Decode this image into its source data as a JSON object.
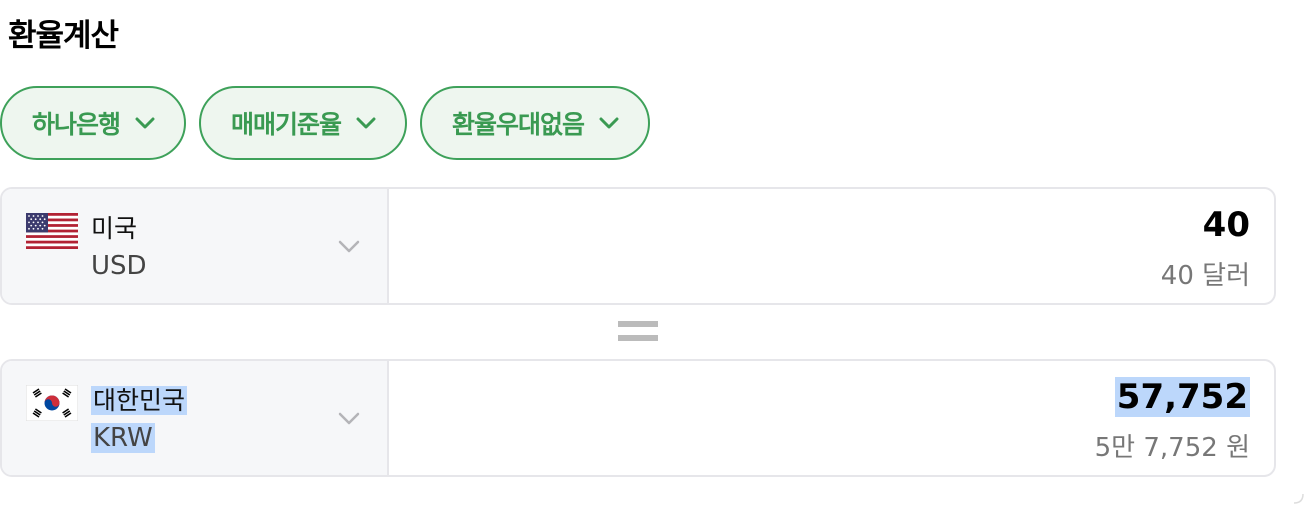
{
  "title": "환율계산",
  "chips": [
    {
      "label": "하나은행"
    },
    {
      "label": "매매기준율"
    },
    {
      "label": "환율우대없음"
    }
  ],
  "from": {
    "country": "미국",
    "code": "USD",
    "flag_icon": "us-flag-icon",
    "amount": "40",
    "amount_words": "40 달러"
  },
  "to": {
    "country": "대한민국",
    "code": "KRW",
    "flag_icon": "kr-flag-icon",
    "amount": "57,752",
    "amount_words": "5만 7,752 원"
  },
  "colors": {
    "accent": "#3ea15a",
    "chip_bg": "#eef6ef",
    "selection": "#bcd7fb"
  }
}
